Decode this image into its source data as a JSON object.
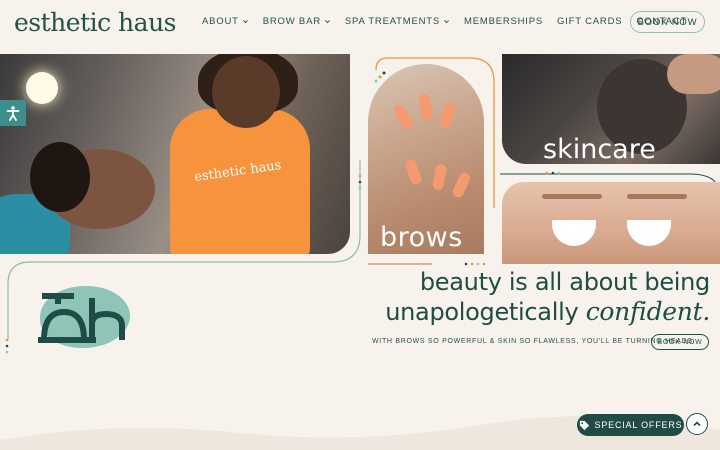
{
  "brand": {
    "logo_text": "esthetic haus"
  },
  "nav": {
    "items": [
      {
        "label": "ABOUT",
        "has_dropdown": true
      },
      {
        "label": "BROW BAR",
        "has_dropdown": true
      },
      {
        "label": "SPA TREATMENTS",
        "has_dropdown": true
      },
      {
        "label": "MEMBERSHIPS",
        "has_dropdown": false
      },
      {
        "label": "GIFT CARDS",
        "has_dropdown": false
      },
      {
        "label": "CONTACT",
        "has_dropdown": false
      }
    ],
    "book_button": "BOOK NOW"
  },
  "hero": {
    "shirt_text": "esthetic haus",
    "brows_label": "brows",
    "skincare_label": "skincare"
  },
  "tagline": {
    "line1": "beauty is all about being",
    "line2_prefix": "unapologetically",
    "line2_emphasis": "confident.",
    "subline": "WITH BROWS SO POWERFUL & SKIN SO FLAWLESS, YOU'LL BE TURNING HEADS.",
    "book_button": "BOOK NOW"
  },
  "widgets": {
    "special_offers": "SPECIAL OFFERS"
  },
  "colors": {
    "primary": "#1f4d45",
    "accent_teal": "#8fc4b8",
    "accent_orange": "#f0963a",
    "background": "#f7f2ec"
  }
}
